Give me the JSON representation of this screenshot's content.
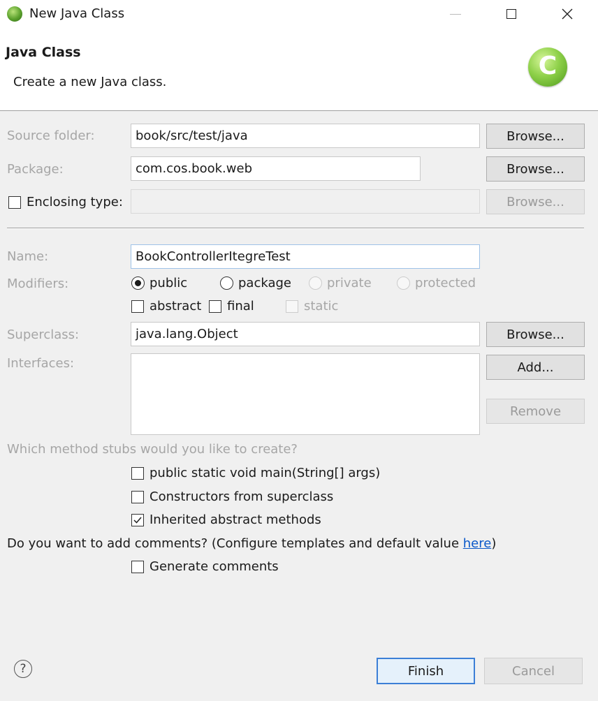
{
  "window": {
    "title": "New Java Class",
    "icon": "eclipse-icon",
    "controls": {
      "minimize": "—",
      "maximize": "☐",
      "close": "✕"
    }
  },
  "header": {
    "title": "Java Class",
    "description": "Create a new Java class.",
    "icon_letter": "C"
  },
  "form": {
    "source_folder": {
      "label": "Source folder:",
      "value": "book/src/test/java",
      "browse": "Browse..."
    },
    "package": {
      "label": "Package:",
      "value": "com.cos.book.web",
      "browse": "Browse..."
    },
    "enclosing_type": {
      "label": "Enclosing type:",
      "checked": false,
      "value": "",
      "browse": "Browse..."
    },
    "name": {
      "label": "Name:",
      "value": "BookControllerItegreTest"
    },
    "modifiers": {
      "label": "Modifiers:",
      "visibility": [
        "public",
        "package",
        "private",
        "protected"
      ],
      "selected": "public",
      "flags": [
        "abstract",
        "final",
        "static"
      ]
    },
    "superclass": {
      "label": "Superclass:",
      "value": "java.lang.Object",
      "browse": "Browse..."
    },
    "interfaces": {
      "label": "Interfaces:",
      "add": "Add...",
      "remove": "Remove"
    }
  },
  "stubs": {
    "question": "Which method stubs would you like to create?",
    "options": [
      {
        "label": "public static void main(String[] args)",
        "checked": false
      },
      {
        "label": "Constructors from superclass",
        "checked": false
      },
      {
        "label": "Inherited abstract methods",
        "checked": true
      }
    ]
  },
  "comments": {
    "question": "Do you want to add comments? (Configure templates and default value ",
    "link": "here",
    "suffix": ")",
    "generate_label": "Generate comments",
    "generate_checked": false
  },
  "footer": {
    "help": "?",
    "finish": "Finish",
    "cancel": "Cancel"
  },
  "colors": {
    "accent": "#3c7fd6",
    "link": "#0a58c9",
    "dialog_bg": "#f0f0f0"
  }
}
